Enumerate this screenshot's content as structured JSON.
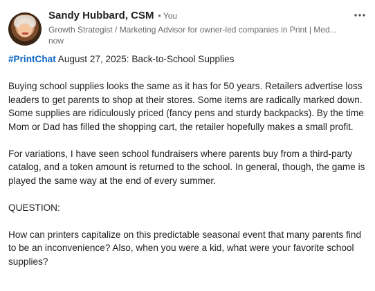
{
  "author": {
    "name": "Sandy Hubbard, CSM",
    "connection": "• You",
    "headline": "Growth Strategist / Marketing Advisor for owner-led companies in Print | Med...",
    "timestamp": "now"
  },
  "post": {
    "hashtag": "#PrintChat",
    "title": " August 27, 2025: Back-to-School Supplies",
    "paragraphs": [
      "Buying school supplies looks the same as it has for 50 years. Retailers advertise loss leaders to get parents to shop at their stores. Some items are radically marked down. Some supplies are ridiculously priced (fancy pens and sturdy backpacks). By the time Mom or Dad has filled the shopping cart, the retailer hopefully makes a small profit.",
      "For variations, I have seen school fundraisers where parents buy from a third-party catalog, and a token amount is returned to the school. In general, though, the game is played the same way at the end of every summer.",
      "QUESTION:",
      "How can printers capitalize on this predictable seasonal event that many parents find to be an inconvenience? Also, when you were a kid, what were your favorite school supplies?"
    ]
  },
  "icons": {
    "more": "more-horizontal-icon"
  },
  "colors": {
    "link": "#0a66c2",
    "text": "#1f1f1f",
    "muted": "#6b6b6b"
  }
}
